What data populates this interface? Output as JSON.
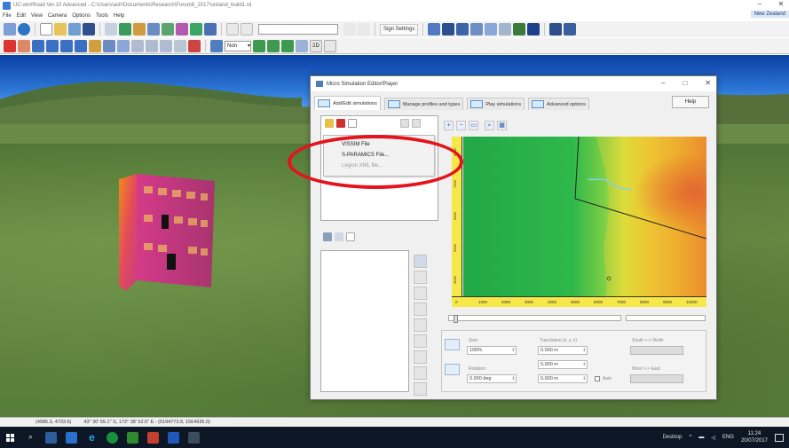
{
  "app": {
    "title": "UC-win/Road Ver.10 Advanced - C:\\Users\\ash\\Documents\\Research\\Forum8_2017\\uniland_build1.rd",
    "menu": [
      "File",
      "Edit",
      "View",
      "Camera",
      "Options",
      "Tools",
      "Help"
    ],
    "user_badge": "New Zealand",
    "toolbar": {
      "sign_settings": "Sign Settings",
      "dropdown_value": "Non"
    }
  },
  "statusbar": {
    "coords": "(4985.3, 4703.6)",
    "latlon": "43°  30' 55.1\" S, 172°  38' 52.6\" E  -  (5194773.8, 1564935.0)"
  },
  "dialog": {
    "title": "Micro Simulation Editor/Player",
    "tabs": [
      {
        "label": "Add/Edit simulations",
        "active": true
      },
      {
        "label": "Manage profiles and types",
        "active": false
      },
      {
        "label": "Play simulations",
        "active": false
      },
      {
        "label": "Advanced options",
        "active": false
      }
    ],
    "help_label": "Help",
    "import_menu": [
      {
        "label": "VISSIM File",
        "enabled": true
      },
      {
        "label": "S-PARAMICS File...",
        "enabled": true
      },
      {
        "label": "Legion XML file...",
        "enabled": false
      }
    ],
    "map": {
      "x_ticks": [
        "0",
        "1000",
        "2000",
        "3000",
        "4000",
        "5000",
        "6000",
        "7000",
        "8000",
        "9000",
        "10000"
      ],
      "y_ticks": [
        "8000",
        "7000",
        "6000",
        "5000",
        "4000"
      ]
    },
    "props": {
      "size_label": "Size:",
      "size_value": "100%",
      "rotation_label": "Rotation:",
      "rotation_value": "0.000 deg",
      "translation_label": "Translation (x, y, z):",
      "tx": "0.000 m",
      "ty": "0.000 m",
      "tz": "0.000 m",
      "auto_label": "Auto",
      "south_north_label": "South <-> North",
      "west_east_label": "West <-> East"
    }
  },
  "taskbar": {
    "desktop_label": "Desktop",
    "lang": "ENG",
    "time": "11:24",
    "date": "20/07/2017"
  },
  "colors": {
    "annotation": "#e3141b",
    "taskbar": "#0d1624"
  }
}
